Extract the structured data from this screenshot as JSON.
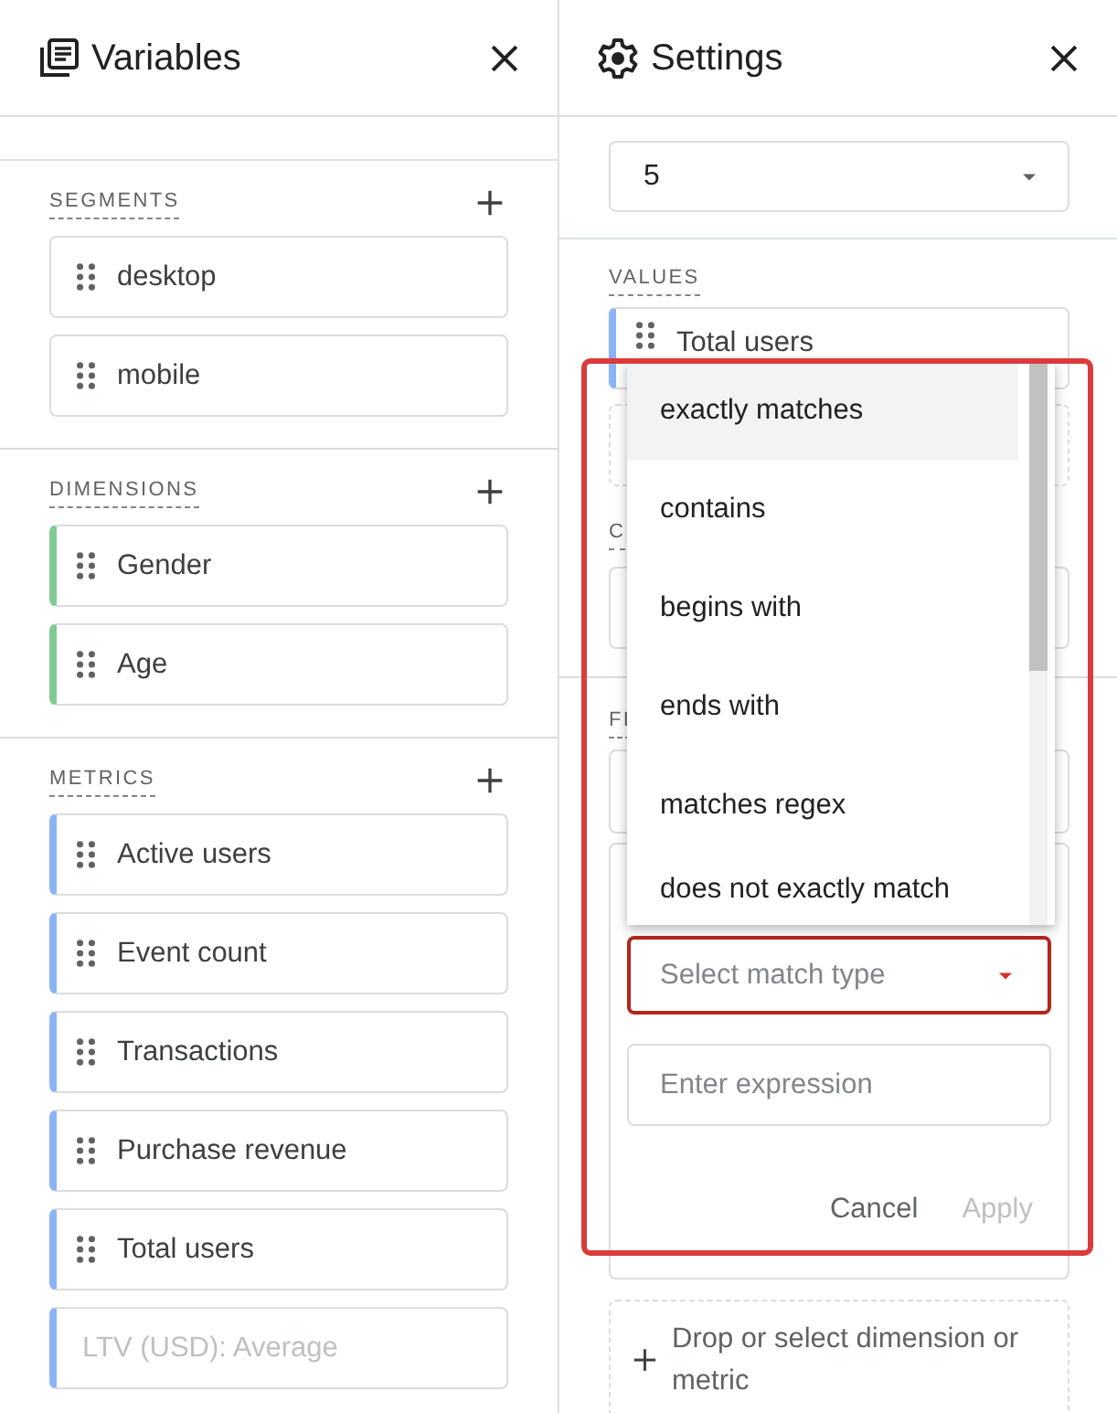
{
  "variables_panel": {
    "title": "Variables",
    "sections": [
      {
        "label": "SEGMENTS",
        "chips": [
          {
            "text": "desktop",
            "disabled": false
          },
          {
            "text": "mobile",
            "disabled": false
          }
        ]
      },
      {
        "label": "DIMENSIONS",
        "chips": [
          {
            "text": "Gender",
            "disabled": false,
            "color": "#81c995"
          },
          {
            "text": "Age",
            "disabled": false,
            "color": "#81c995"
          }
        ]
      },
      {
        "label": "METRICS",
        "chips": [
          {
            "text": "Active users",
            "disabled": false,
            "color": "#8ab4f8"
          },
          {
            "text": "Event count",
            "disabled": false,
            "color": "#8ab4f8"
          },
          {
            "text": "Transactions",
            "disabled": false,
            "color": "#8ab4f8"
          },
          {
            "text": "Purchase revenue",
            "disabled": false,
            "color": "#8ab4f8"
          },
          {
            "text": "Total users",
            "disabled": false,
            "color": "#8ab4f8"
          },
          {
            "text": "LTV (USD): Average",
            "disabled": true,
            "color": "#8ab4f8"
          }
        ]
      }
    ]
  },
  "settings_panel": {
    "title": "Settings",
    "rows_select": {
      "value": "5"
    },
    "values": {
      "label": "VALUES",
      "chips": [
        {
          "text": "Total users",
          "color": "#8ab4f8"
        }
      ]
    },
    "cut_labels": [
      "C",
      "FI"
    ],
    "filter": {
      "match_type": {
        "placeholder": "Select match type",
        "invalid": true
      },
      "expression": {
        "placeholder": "Enter expression"
      },
      "buttons": [
        {
          "label": "Cancel",
          "disabled": false
        },
        {
          "label": "Apply",
          "disabled": true
        }
      ]
    },
    "drop_zone": "Drop or select dimension or metric"
  },
  "match_menu": {
    "options": [
      {
        "label": "exactly matches",
        "selected": true
      },
      {
        "label": "contains",
        "selected": false
      },
      {
        "label": "begins with",
        "selected": false
      },
      {
        "label": "ends with",
        "selected": false
      },
      {
        "label": "matches regex",
        "selected": false
      },
      {
        "label": "does not exactly match",
        "selected": false
      }
    ]
  }
}
